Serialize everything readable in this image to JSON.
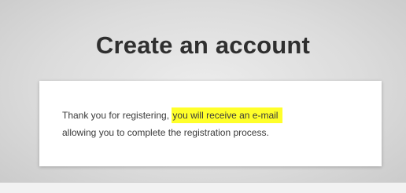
{
  "page": {
    "title": "Create an account"
  },
  "message": {
    "line1_prefix": "Thank you for registering,",
    "line1_highlight": "you will receive an e-mail",
    "line2": "allowing you to complete the registration process."
  },
  "colors": {
    "highlight": "#ffff2a",
    "card_background": "#ffffff",
    "title_text": "#2f2f2f"
  }
}
